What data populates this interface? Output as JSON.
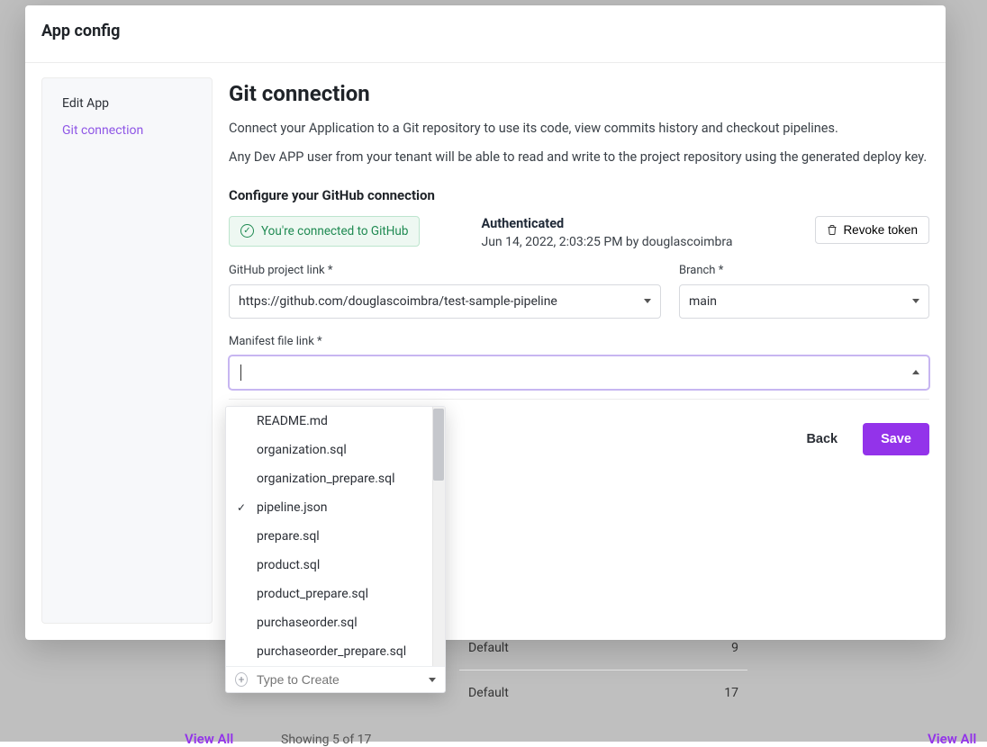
{
  "modal": {
    "title": "App config",
    "sidebar": {
      "items": [
        {
          "label": "Edit App",
          "active": false
        },
        {
          "label": "Git connection",
          "active": true
        }
      ]
    },
    "content": {
      "heading": "Git connection",
      "desc1": "Connect your Application to a Git repository to use its code, view commits history and checkout pipelines.",
      "desc2": "Any Dev APP user from your tenant will be able to read and write to the project repository using the generated deploy key.",
      "sub_heading": "Configure your GitHub connection",
      "connected_badge": "You're connected to GitHub",
      "auth_title": "Authenticated",
      "auth_meta": "Jun 14, 2022, 2:03:25 PM by douglascoimbra",
      "revoke_label": "Revoke token",
      "project_label": "GitHub project link *",
      "project_value": "https://github.com/douglascoimbra/test-sample-pipeline",
      "branch_label": "Branch *",
      "branch_value": "main",
      "manifest_label": "Manifest file link *",
      "manifest_value": "",
      "back_label": "Back",
      "save_label": "Save"
    },
    "dropdown": {
      "items": [
        {
          "label": "README.md",
          "selected": false
        },
        {
          "label": "organization.sql",
          "selected": false
        },
        {
          "label": "organization_prepare.sql",
          "selected": false
        },
        {
          "label": "pipeline.json",
          "selected": true
        },
        {
          "label": "prepare.sql",
          "selected": false
        },
        {
          "label": "product.sql",
          "selected": false
        },
        {
          "label": "product_prepare.sql",
          "selected": false
        },
        {
          "label": "purchaseorder.sql",
          "selected": false
        },
        {
          "label": "purchaseorder_prepare.sql",
          "selected": false
        }
      ],
      "create_placeholder": "Type to Create"
    }
  },
  "background": {
    "rows": [
      {
        "label": "Default",
        "count": "9"
      },
      {
        "label": "Default",
        "count": "17"
      }
    ],
    "view_all": "View All",
    "showing": "Showing 5 of 17"
  }
}
